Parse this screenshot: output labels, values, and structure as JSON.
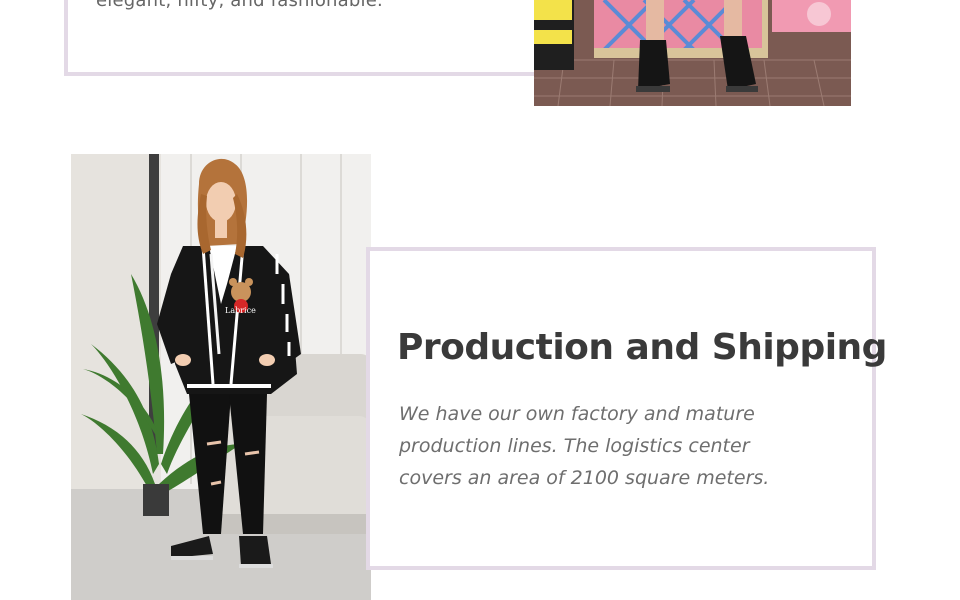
{
  "section_top": {
    "text_fragment": "elegant, nifty, and fashionable."
  },
  "section_main": {
    "title": "Production and Shipping",
    "description_lines": [
      "We have our own factory and mature",
      "production lines. The logistics center",
      "covers an area of 2100 square meters."
    ],
    "product_logo_text": "Labrice"
  },
  "colors": {
    "card_border": "#e3d9e6",
    "title_text": "#3a3a3a",
    "body_text": "#6e6e6e"
  }
}
